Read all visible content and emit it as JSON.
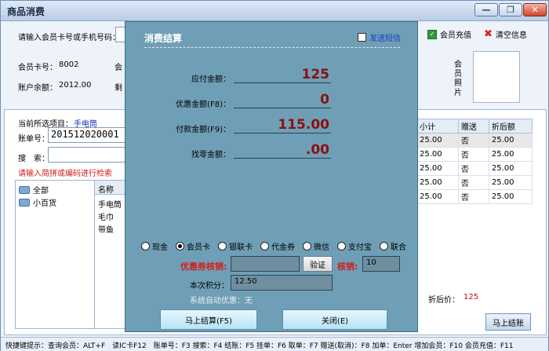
{
  "window": {
    "title": "商品消费"
  },
  "member": {
    "search_label": "请输入会员卡号或手机号码：",
    "card_label": "会员卡号：",
    "card_value": "8002",
    "balance_label": "账户余额：",
    "balance_value": "2012.00",
    "member_cut_label": "会",
    "remain_cut_label": "剩",
    "photo_label": "会员照片"
  },
  "toolbar": {
    "recharge_label": "会员充值",
    "clear_label": "清空信息"
  },
  "order": {
    "current_label": "当前所选项目：",
    "current_value": "手电筒",
    "bill_label": "账单号：",
    "bill_value": "201512020001",
    "search_label": "搜　索：",
    "hint": "请输入简拼或编码进行检索"
  },
  "tree": {
    "root": "全部",
    "child": "小百货"
  },
  "product_list": {
    "header": "名称",
    "items": [
      "手电筒",
      "毛巾",
      "带鱼"
    ]
  },
  "cart": {
    "headers": [
      "小计",
      "赠送",
      "折后额"
    ],
    "rows": [
      [
        "25.00",
        "否",
        "25.00"
      ],
      [
        "25.00",
        "否",
        "25.00"
      ],
      [
        "25.00",
        "否",
        "25.00"
      ],
      [
        "25.00",
        "否",
        "25.00"
      ],
      [
        "25.00",
        "否",
        "25.00"
      ]
    ],
    "discount_label": "折后价：",
    "discount_value": "125",
    "checkout_button": "马上结账"
  },
  "status": {
    "text": "快捷键提示：查询会员：ALT+F　读IC卡F12　账单号：F3 搜索：F4 结账：F5 挂单：F6 取单：F7 赠送(取消)：F8 加单：Enter 增加会员：F10 会员充值：F11"
  },
  "dialog": {
    "title": "消费结算",
    "sms_label": "发送短信",
    "due_label": "应付金额：",
    "due_value": "125",
    "discount_label": "优惠金额(F8)：",
    "discount_value": "0",
    "paid_label": "付款金额(F9)：",
    "paid_value": "115.00",
    "change_label": "找零金额：",
    "change_value": ".00",
    "payment_methods": [
      "现金",
      "会员卡",
      "银联卡",
      "代金券",
      "微信",
      "支付宝",
      "联合"
    ],
    "selected_payment": "会员卡",
    "coupon_label": "优惠券核销:",
    "verify_button": "验证",
    "verify_label": "核销:",
    "verify_value": "10",
    "points_label": "本次积分：",
    "points_value": "12.50",
    "auto_discount": "系统自动优惠：无",
    "pay_button": "马上结算(F5)",
    "close_button": "关闭(E)"
  }
}
